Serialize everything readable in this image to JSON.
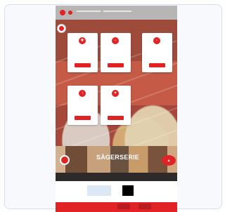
{
  "window": {
    "title": "",
    "accent": "#e22326",
    "frame_color": "#f7f9fc"
  },
  "topbar": {
    "logo_icon": "club-logo-icon",
    "line1": "",
    "line2": ""
  },
  "header": {
    "headline": "",
    "logo_icon": "club-logo-icon"
  },
  "cards": [
    {
      "icon": "shield-icon",
      "title": "",
      "meta": "",
      "button": ""
    },
    {
      "icon": "shield-icon",
      "title": "",
      "meta": "",
      "button": ""
    },
    {
      "icon": "shield-icon",
      "title": "",
      "meta": "",
      "button": ""
    },
    {
      "icon": "shield-icon",
      "title": "",
      "meta": "",
      "button": ""
    },
    {
      "icon": "shield-icon",
      "title": "",
      "meta": "",
      "button": ""
    }
  ],
  "banner": {
    "title": "SÄGERSERIE",
    "subtitle": "",
    "left_icon": "club-logo-icon",
    "badge_icon": "badge-icon"
  },
  "sponsors": [
    {
      "label": "",
      "color": "#1f5fa6"
    },
    {
      "label": "",
      "color": "#4a6fb1"
    },
    {
      "label": "",
      "color": "#000000"
    },
    {
      "label": "",
      "color": "#e22326"
    }
  ],
  "footer": {
    "buttons": [
      "",
      ""
    ],
    "wordmark": ""
  }
}
